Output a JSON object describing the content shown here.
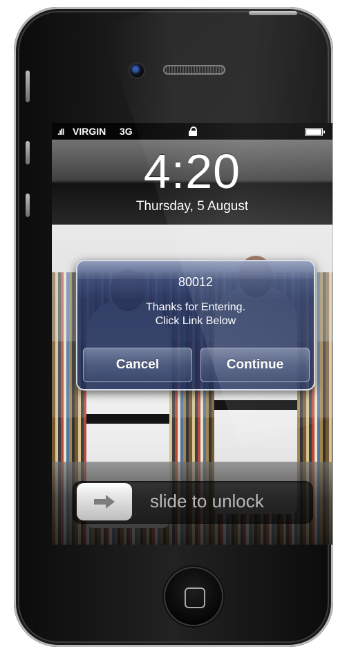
{
  "statusbar": {
    "signal": ".ıll",
    "carrier": "VIRGIN",
    "network": "3G"
  },
  "lockscreen": {
    "time": "4:20",
    "date": "Thursday, 5 August"
  },
  "alert": {
    "title": "80012",
    "message_line1": "Thanks for Entering.",
    "message_line2": "Click Link Below",
    "cancel_label": "Cancel",
    "continue_label": "Continue"
  },
  "unlock": {
    "label": "slide to unlock"
  },
  "icons": {
    "lock": "lock-icon",
    "battery": "battery-icon",
    "arrow": "arrow-right-icon",
    "home": "home-button-icon"
  },
  "colors": {
    "alert_bg": "#20305c",
    "phone_frame": "#0b0b0b",
    "unlock_text": "#b8b8b8"
  }
}
